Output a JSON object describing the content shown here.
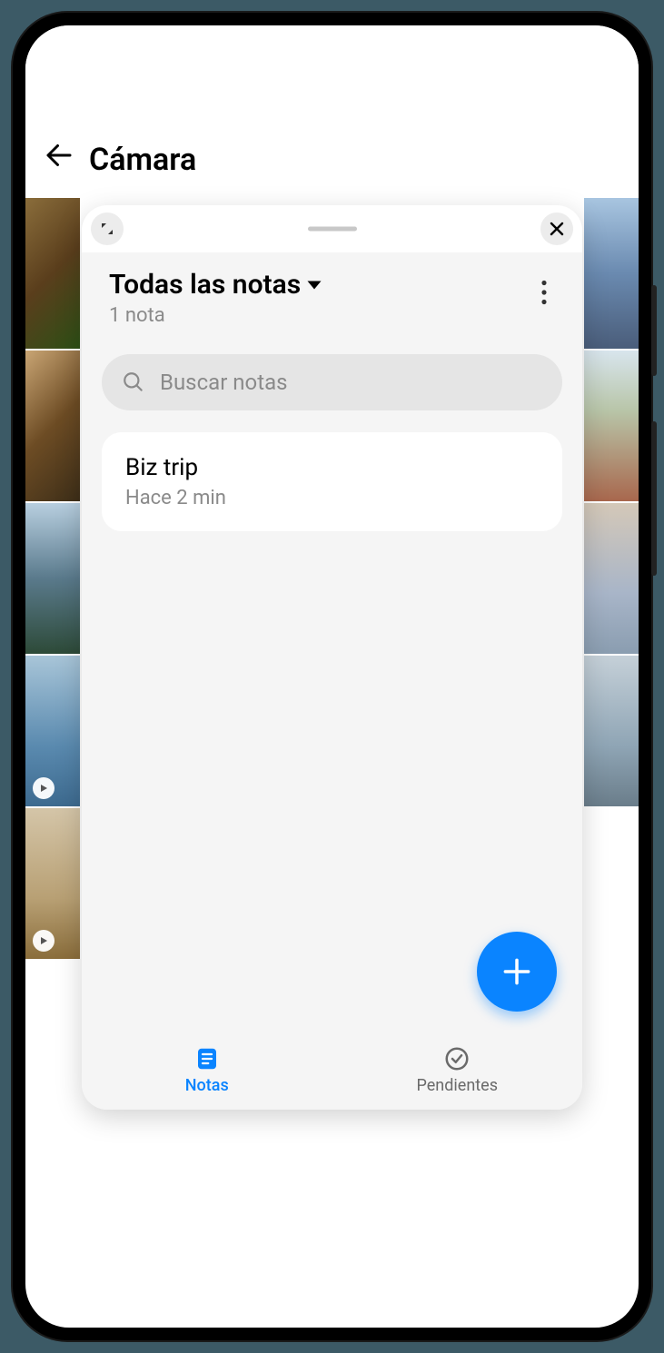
{
  "background_app": {
    "title": "Cámara"
  },
  "overlay": {
    "header": {
      "title": "Todas las notas",
      "subtitle": "1 nota"
    },
    "search": {
      "placeholder": "Buscar notas"
    },
    "notes": [
      {
        "title": "Biz trip",
        "time": "Hace 2 min"
      }
    ],
    "tabs": {
      "notes": "Notas",
      "todos": "Pendientes"
    }
  }
}
